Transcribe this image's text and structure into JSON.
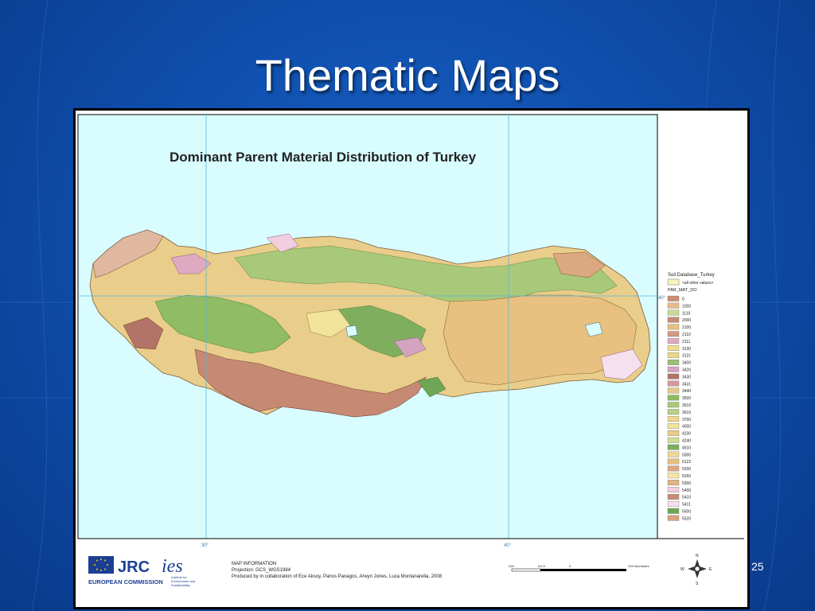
{
  "slide": {
    "title": "Thematic Maps",
    "number": "25"
  },
  "map": {
    "title": "Dominant Parent Material Distribution of Turkey",
    "meridian_labels": [
      "30°",
      "40°"
    ],
    "parallel_label": "40°",
    "legend": {
      "title": "Soil Database_Turkey",
      "other_label": "<all other values>",
      "field": "PAR_MAT_DO",
      "items": [
        {
          "label": "0",
          "color": "#cf8e73"
        },
        {
          "label": "1000",
          "color": "#e7b98a"
        },
        {
          "label": "1110",
          "color": "#cbd996"
        },
        {
          "label": "2000",
          "color": "#c68a74"
        },
        {
          "label": "2100",
          "color": "#e5c081"
        },
        {
          "label": "2110",
          "color": "#d29b7e"
        },
        {
          "label": "2111",
          "color": "#deaac2"
        },
        {
          "label": "3130",
          "color": "#f0dc93"
        },
        {
          "label": "3131",
          "color": "#e8d98c"
        },
        {
          "label": "3400",
          "color": "#9fbd74"
        },
        {
          "label": "3420",
          "color": "#d3a3c0"
        },
        {
          "label": "3430",
          "color": "#b27466"
        },
        {
          "label": "3431",
          "color": "#d49a9b"
        },
        {
          "label": "3440",
          "color": "#e6c88c"
        },
        {
          "label": "3500",
          "color": "#8fbc64"
        },
        {
          "label": "3510",
          "color": "#a9c97a"
        },
        {
          "label": "3610",
          "color": "#b8d286"
        },
        {
          "label": "3700",
          "color": "#efd88c"
        },
        {
          "label": "4000",
          "color": "#f3e49c"
        },
        {
          "label": "4230",
          "color": "#e9c98a"
        },
        {
          "label": "4240",
          "color": "#cfdc98"
        },
        {
          "label": "4510",
          "color": "#7fae5e"
        },
        {
          "label": "5000",
          "color": "#eed699"
        },
        {
          "label": "5122",
          "color": "#e8c07f"
        },
        {
          "label": "5200",
          "color": "#dca880"
        },
        {
          "label": "5260",
          "color": "#f6e6a4"
        },
        {
          "label": "5300",
          "color": "#e2b484"
        },
        {
          "label": "5400",
          "color": "#f1cfe0"
        },
        {
          "label": "5410",
          "color": "#c98a79"
        },
        {
          "label": "5411",
          "color": "#f6e0ee"
        },
        {
          "label": "5500",
          "color": "#6fa655"
        },
        {
          "label": "5520",
          "color": "#dba27e"
        }
      ]
    },
    "footer": {
      "jrc_label": "JRC",
      "ec_label": "EUROPEAN COMMISSION",
      "ies_label": "ies",
      "ies_sub": [
        "Institute for",
        "Environment and",
        "Sustainability"
      ],
      "info_heading": "MAP INFORMATION",
      "projection": "Projection: GCS_WGS1984",
      "credits": "Produced by in collaboration of Ece Aksoy, Panos Panagos, Arwyn Jones, Luca Montanarella, 2008",
      "scale_labels": [
        "225",
        "112,5",
        "0",
        "225 Kilometers"
      ],
      "compass": {
        "n": "N",
        "s": "S",
        "e": "E",
        "w": "W"
      }
    }
  }
}
